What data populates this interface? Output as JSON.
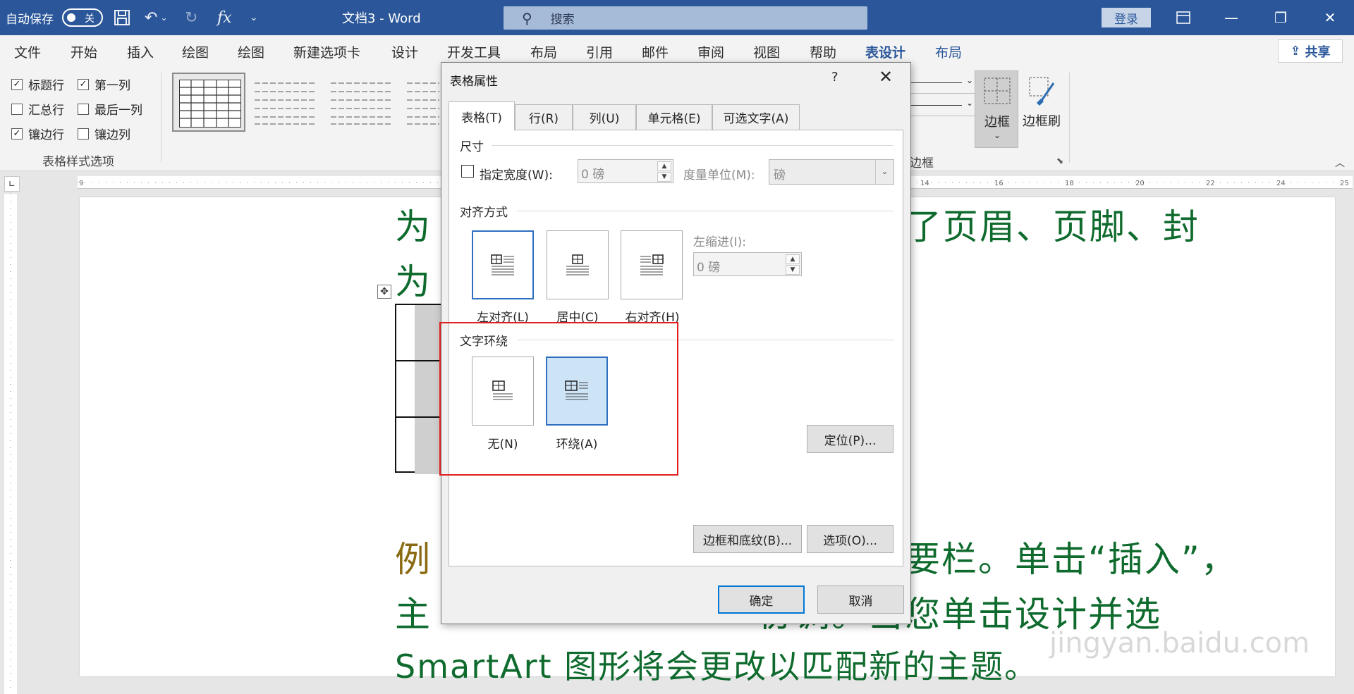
{
  "titlebar": {
    "autosave_label": "自动保存",
    "autosave_state": "关",
    "doc_title": "文档3  -  Word",
    "search_placeholder": "搜索",
    "login": "登录"
  },
  "menu": {
    "tabs": [
      "文件",
      "开始",
      "插入",
      "绘图",
      "绘图",
      "新建选项卡",
      "设计",
      "开发工具",
      "布局",
      "引用",
      "邮件",
      "审阅",
      "视图",
      "帮助",
      "表设计",
      "布局"
    ],
    "active": "表设计",
    "share": "共享"
  },
  "ribbon": {
    "options": [
      {
        "label": "标题行",
        "checked": true
      },
      {
        "label": "第一列",
        "checked": true
      },
      {
        "label": "汇总行",
        "checked": false
      },
      {
        "label": "最后一列",
        "checked": false
      },
      {
        "label": "镶边行",
        "checked": true
      },
      {
        "label": "镶边列",
        "checked": false
      }
    ],
    "options_group_label": "表格样式选项",
    "border_label": "边框",
    "painter_label": "边框刷",
    "border_group_label": "边框"
  },
  "document": {
    "line1_left": "为",
    "line1_right": "ord  提供了页眉、页脚、封",
    "line2_left": "为",
    "line3_left": "例",
    "line3_right": "页眉和提要栏。单击“插入”，",
    "line4_left": "主",
    "line4_right": "协调。当您单击设计并选",
    "line5": "SmartArt  图形将会更改以匹配新的主题。",
    "watermark": "jingyan.baidu.com"
  },
  "dialog": {
    "title": "表格属性",
    "help": "?",
    "tabs": [
      "表格(T)",
      "行(R)",
      "列(U)",
      "单元格(E)",
      "可选文字(A)"
    ],
    "size_section": "尺寸",
    "preferred_width_label": "指定宽度(W):",
    "preferred_width_value": "0 磅",
    "measure_label": "度量单位(M):",
    "measure_value": "磅",
    "alignment_section": "对齐方式",
    "align_left": "左对齐(L)",
    "align_center": "居中(C)",
    "align_right": "右对齐(H)",
    "indent_label": "左缩进(I):",
    "indent_value": "0 磅",
    "wrap_section": "文字环绕",
    "wrap_none": "无(N)",
    "wrap_around": "环绕(A)",
    "positioning": "定位(P)...",
    "borders_shading": "边框和底纹(B)...",
    "options": "选项(O)...",
    "ok": "确定",
    "cancel": "取消"
  }
}
